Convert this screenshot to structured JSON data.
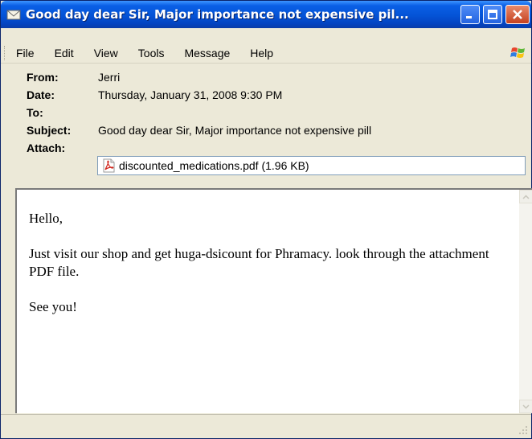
{
  "window": {
    "title": "Good day dear Sir, Major importance not expensive pil...",
    "title_icon": "envelope-icon",
    "accent": "#0453d6"
  },
  "menu": {
    "items": [
      "File",
      "Edit",
      "View",
      "Tools",
      "Message",
      "Help"
    ]
  },
  "headers": {
    "from_label": "From:",
    "from_value": "Jerri",
    "date_label": "Date:",
    "date_value": "Thursday, January 31, 2008 9:30 PM",
    "to_label": "To:",
    "to_value": "",
    "subject_label": "Subject:",
    "subject_value": "Good day dear Sir, Major importance not expensive pill",
    "attach_label": "Attach:",
    "attachment": "discounted_medications.pdf (1.96 KB)"
  },
  "body": {
    "paragraphs": [
      "Hello,",
      "Just visit our shop and get huga-dsicount for Phramacy. look through the attachment PDF file.",
      "See you!"
    ]
  }
}
